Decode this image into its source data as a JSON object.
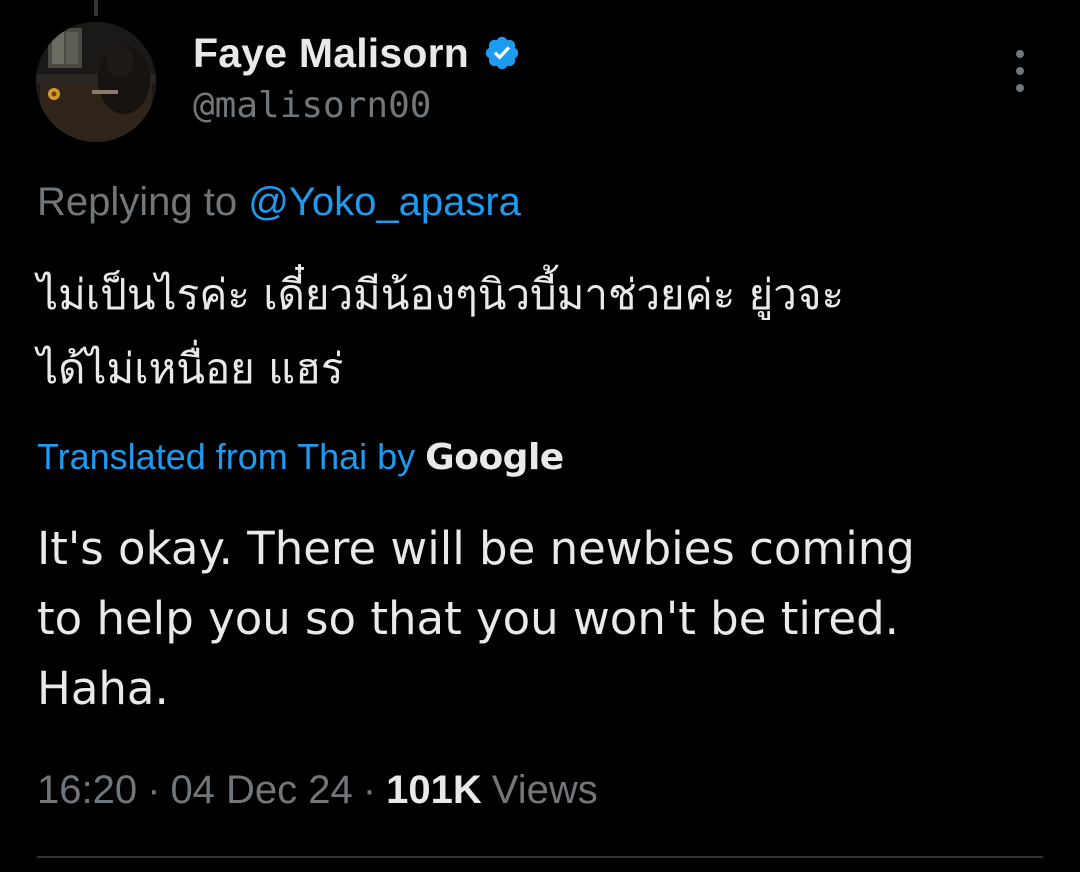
{
  "author": {
    "display_name": "Faye Malisorn",
    "handle": "@malisorn00",
    "verified": true,
    "verified_icon": "verified-badge-icon",
    "avatar_icon": "user-avatar"
  },
  "menu": {
    "icon": "more-vertical-icon"
  },
  "reply": {
    "prefix": "Replying to",
    "mention": "@Yoko_apasra"
  },
  "tweet": {
    "text_line_1": "ไม่เป็นไรค่ะ เดี๋ยวมีน้องๆนิวบี้มาช่วยค่ะ ยู่วจะ",
    "text_line_2": "ได้ไม่เหนื่อย แฮร่"
  },
  "translation": {
    "label": "Translated from Thai by",
    "provider": "Google",
    "line_1": "It's okay. There will be newbies coming",
    "line_2": "to help you so that you won't be tired.",
    "line_3": "Haha."
  },
  "meta": {
    "time": "16:20",
    "separator": "·",
    "date": "04 Dec 24",
    "views_count": "101K",
    "views_label": "Views"
  },
  "colors": {
    "background": "#000000",
    "primary_text": "#e7e9ea",
    "secondary_text": "#71767b",
    "accent": "#1d9bf0",
    "divider": "#2f3336"
  }
}
